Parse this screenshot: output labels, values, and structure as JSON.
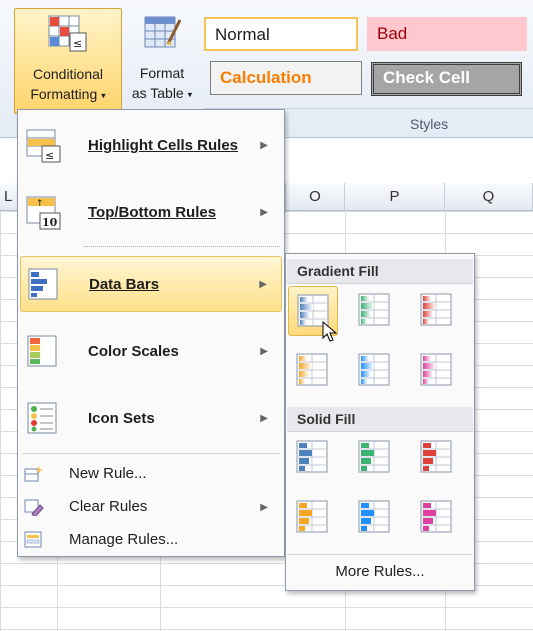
{
  "ribbon": {
    "conditional_formatting": {
      "line1": "Conditional",
      "line2": "Formatting"
    },
    "format_as_table": {
      "line1": "Format",
      "line2": "as Table"
    },
    "styles": {
      "normal": "Normal",
      "bad": "Bad",
      "calculation": "Calculation",
      "check_cell": "Check Cell",
      "group_label": "Styles"
    }
  },
  "sheet": {
    "columns": [
      "O",
      "P",
      "Q"
    ],
    "partial_column_glyph": "L"
  },
  "menu": {
    "items": [
      {
        "label": "Highlight Cells Rules",
        "icon": "highlight-cells-icon",
        "has_submenu": true
      },
      {
        "label": "Top/Bottom Rules",
        "icon": "top-bottom-icon",
        "has_submenu": true
      },
      {
        "label": "Data Bars",
        "icon": "data-bars-icon",
        "has_submenu": true,
        "highlighted": true
      },
      {
        "label": "Color Scales",
        "icon": "color-scales-icon",
        "has_submenu": true
      },
      {
        "label": "Icon Sets",
        "icon": "icon-sets-icon",
        "has_submenu": true
      }
    ],
    "commands": [
      {
        "label": "New Rule...",
        "icon": "new-rule-icon",
        "has_submenu": false
      },
      {
        "label": "Clear Rules",
        "icon": "clear-rules-icon",
        "has_submenu": true
      },
      {
        "label": "Manage Rules...",
        "icon": "manage-rules-icon",
        "has_submenu": false
      }
    ]
  },
  "data_bars_submenu": {
    "gradient_fill": "Gradient Fill",
    "solid_fill": "Solid Fill",
    "more_rules": "More Rules...",
    "colors": [
      "#4f81bd",
      "#3cb371",
      "#e0403a",
      "#f5a623",
      "#1e90ff",
      "#e040a0"
    ]
  }
}
